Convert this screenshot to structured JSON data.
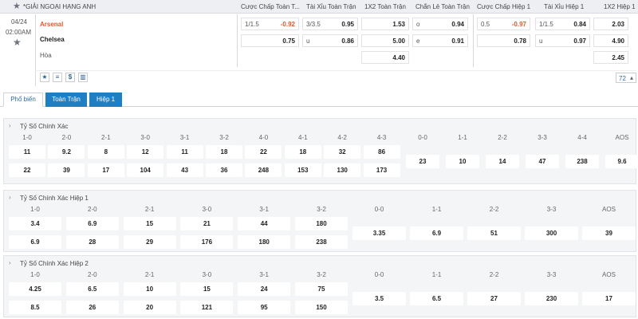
{
  "header": {
    "league": "*GIẢI NGOẠI HẠNG ANH",
    "columns": [
      "Cược Chấp Toàn T...",
      "Tài Xỉu Toàn Trận",
      "1X2 Toàn Trận",
      "Chẵn Lẻ Toàn Trận",
      "Cược Chấp Hiệp 1",
      "Tài Xỉu Hiệp 1",
      "1X2 Hiệp 1"
    ]
  },
  "match": {
    "date": "04/24",
    "time": "02:00AM",
    "home": "Arsenal",
    "away": "Chelsea",
    "draw": "Hòa",
    "more_count": "72",
    "hdp_ft": [
      {
        "label": "1/1.5",
        "value": "-0.92"
      },
      {
        "label": "",
        "value": "0.75"
      }
    ],
    "ou_ft": [
      {
        "label": "3/3.5",
        "value": "0.95"
      },
      {
        "label": "u",
        "value": "0.86"
      }
    ],
    "x12_ft": [
      "1.53",
      "5.00",
      "4.40"
    ],
    "oe_ft": [
      {
        "label": "o",
        "value": "0.94"
      },
      {
        "label": "e",
        "value": "0.91"
      }
    ],
    "hdp_h1": [
      {
        "label": "0.5",
        "value": "-0.97"
      },
      {
        "label": "",
        "value": "0.78"
      }
    ],
    "ou_h1": [
      {
        "label": "1/1.5",
        "value": "0.84"
      },
      {
        "label": "u",
        "value": "0.97"
      }
    ],
    "x12_h1": [
      "2.03",
      "4.90",
      "2.45"
    ]
  },
  "tabs": [
    "Phổ biến",
    "Toàn Trận",
    "Hiệp 1"
  ],
  "sections": [
    {
      "title": "Tỷ Số Chính Xác",
      "left_headers": [
        "1-0",
        "2-0",
        "2-1",
        "3-0",
        "3-1",
        "3-2",
        "4-0",
        "4-1",
        "4-2",
        "4-3"
      ],
      "row1": [
        "11",
        "9.2",
        "8",
        "12",
        "11",
        "18",
        "22",
        "18",
        "32",
        "86"
      ],
      "row2": [
        "22",
        "39",
        "17",
        "104",
        "43",
        "36",
        "248",
        "153",
        "130",
        "173"
      ],
      "right_headers": [
        "0-0",
        "1-1",
        "2-2",
        "3-3",
        "4-4",
        "AOS"
      ],
      "right_values": [
        "23",
        "10",
        "14",
        "47",
        "238",
        "9.6"
      ]
    },
    {
      "title": "Tỷ Số Chính Xác Hiệp 1",
      "left_headers": [
        "1-0",
        "2-0",
        "2-1",
        "3-0",
        "3-1",
        "3-2"
      ],
      "row1": [
        "3.4",
        "6.9",
        "15",
        "21",
        "44",
        "180"
      ],
      "row2": [
        "6.9",
        "28",
        "29",
        "176",
        "180",
        "238"
      ],
      "right_headers": [
        "0-0",
        "1-1",
        "2-2",
        "3-3",
        "AOS"
      ],
      "right_values": [
        "3.35",
        "6.9",
        "51",
        "300",
        "39"
      ]
    },
    {
      "title": "Tỷ Số Chính Xác Hiệp 2",
      "left_headers": [
        "1-0",
        "2-0",
        "2-1",
        "3-0",
        "3-1",
        "3-2"
      ],
      "row1": [
        "4.25",
        "6.5",
        "10",
        "15",
        "24",
        "75"
      ],
      "row2": [
        "8.5",
        "26",
        "20",
        "121",
        "95",
        "150"
      ],
      "right_headers": [
        "0-0",
        "1-1",
        "2-2",
        "3-3",
        "AOS"
      ],
      "right_values": [
        "3.5",
        "6.5",
        "27",
        "230",
        "17"
      ]
    }
  ]
}
